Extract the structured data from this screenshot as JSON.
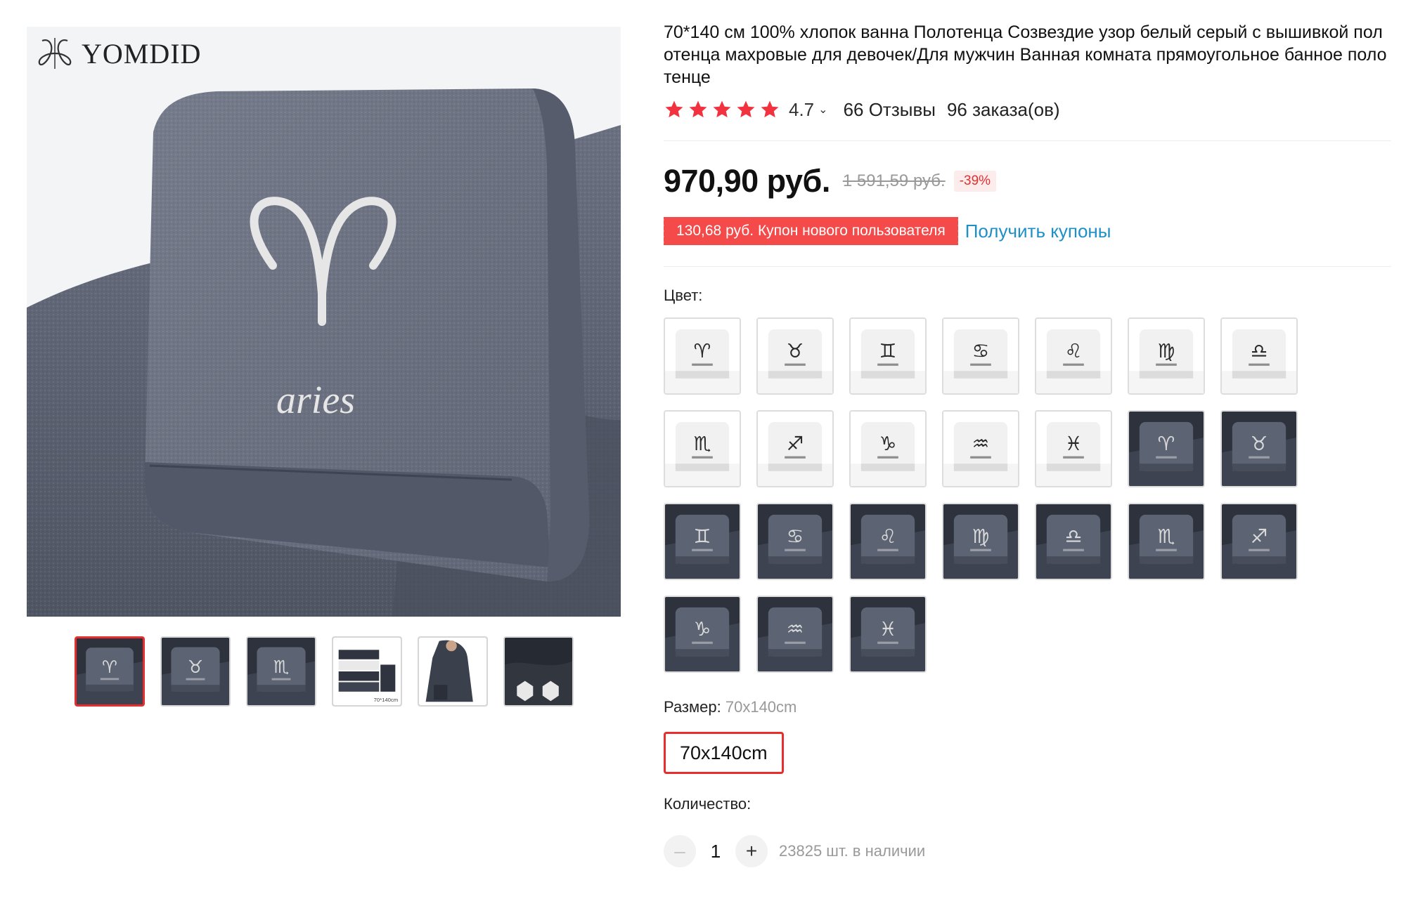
{
  "brand": {
    "name": "YOMDID"
  },
  "gallery": {
    "main_caption": "aries",
    "thumb_caption_5": "70*140cm",
    "thumbnails": [
      {
        "name": "aries",
        "selected": true
      },
      {
        "name": "taurus",
        "selected": false
      },
      {
        "name": "scorpio",
        "selected": false
      },
      {
        "name": "stack",
        "selected": false
      },
      {
        "name": "model",
        "selected": false
      },
      {
        "name": "detail",
        "selected": false
      }
    ]
  },
  "product": {
    "title": "70*140 см 100% хлопок ванна Полотенца Созвездие узор белый серый с вышивкой полотенца махровые для девочек/Для мужчин Ванная комната прямоугольное банное полотенце",
    "rating": "4.7",
    "reviews": "66 Отзывы",
    "orders": "96 заказа(ов)",
    "price": "970,90 руб.",
    "old_price": "1 591,59 руб.",
    "discount": "-39%",
    "coupon_text": "130,68 руб. Купон нового пользователя",
    "coupon_link": "Получить купоны"
  },
  "color": {
    "label": "Цвет:",
    "swatches": [
      {
        "sign": "♈",
        "tone": "white"
      },
      {
        "sign": "♉",
        "tone": "white"
      },
      {
        "sign": "♊",
        "tone": "white"
      },
      {
        "sign": "♋",
        "tone": "white"
      },
      {
        "sign": "♌",
        "tone": "white"
      },
      {
        "sign": "♍",
        "tone": "white"
      },
      {
        "sign": "♎",
        "tone": "white"
      },
      {
        "sign": "♏",
        "tone": "white"
      },
      {
        "sign": "♐",
        "tone": "white"
      },
      {
        "sign": "♑",
        "tone": "white"
      },
      {
        "sign": "♒",
        "tone": "white"
      },
      {
        "sign": "♓",
        "tone": "white"
      },
      {
        "sign": "♈",
        "tone": "gray"
      },
      {
        "sign": "♉",
        "tone": "gray"
      },
      {
        "sign": "♊",
        "tone": "gray"
      },
      {
        "sign": "♋",
        "tone": "gray"
      },
      {
        "sign": "♌",
        "tone": "gray"
      },
      {
        "sign": "♍",
        "tone": "gray"
      },
      {
        "sign": "♎",
        "tone": "gray"
      },
      {
        "sign": "♏",
        "tone": "gray"
      },
      {
        "sign": "♐",
        "tone": "gray"
      },
      {
        "sign": "♑",
        "tone": "gray"
      },
      {
        "sign": "♒",
        "tone": "gray"
      },
      {
        "sign": "♓",
        "tone": "gray"
      }
    ]
  },
  "size": {
    "label": "Размер:",
    "selected": "70x140cm",
    "options": [
      "70x140cm"
    ]
  },
  "quantity": {
    "label": "Количество:",
    "value": "1",
    "minus": "–",
    "plus": "+",
    "stock": "23825 шт. в наличии"
  },
  "colors": {
    "accent": "#e62e2e",
    "coupon": "#f44a4a",
    "link": "#1e8fc7",
    "towel_gray": "#5c6373",
    "star": "#f2323f"
  },
  "icons": {
    "star": "star-icon",
    "chevron": "chevron-down-icon",
    "minus": "minus-icon",
    "plus": "plus-icon"
  }
}
